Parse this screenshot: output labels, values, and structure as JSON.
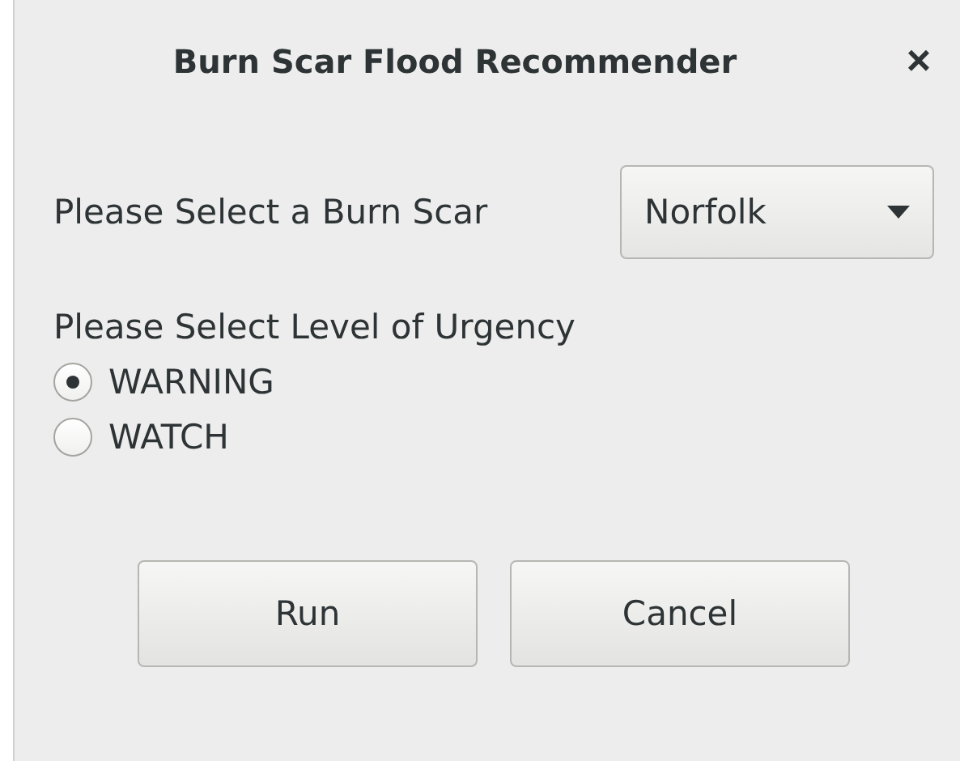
{
  "window": {
    "title": "Burn Scar Flood Recommender",
    "close": "×"
  },
  "burn_scar": {
    "label": "Please Select a Burn Scar",
    "value": "Norfolk"
  },
  "urgency": {
    "label": "Please Select Level of Urgency",
    "options": [
      {
        "label": "WARNING",
        "selected": true
      },
      {
        "label": "WATCH",
        "selected": false
      }
    ]
  },
  "buttons": [
    "Run",
    "Cancel"
  ]
}
